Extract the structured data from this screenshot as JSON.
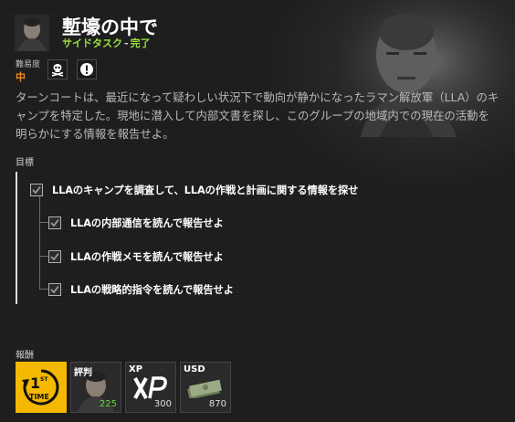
{
  "mission": {
    "title": "塹壕の中で",
    "type_label": "サイドタスク",
    "separator": "-",
    "status": "完了",
    "difficulty_label": "難易度",
    "difficulty_value": "中",
    "description": "ターンコートは、最近になって疑わしい状況下で動向が静かになったラマン解放軍（LLA）のキャンプを特定した。現地に潜入して内部文書を探し、このグループの地域内での現在の活動を明らかにする情報を報告せよ。"
  },
  "modifiers": [
    "skull-icon",
    "exclamation-icon"
  ],
  "objectives": {
    "label": "目標",
    "main": "LLAのキャンプを調査して、LLAの作戦と計画に関する情報を探せ",
    "sub": [
      "LLAの内部通信を読んで報告せよ",
      "LLAの作戦メモを読んで報告せよ",
      "LLAの戦略的指令を読んで報告せよ"
    ]
  },
  "rewards": {
    "label": "報酬",
    "items": [
      {
        "label": "",
        "value": "",
        "badge_top": "1",
        "badge_sup": "ST",
        "badge_bottom": "TIME",
        "icon": "first-time-icon",
        "color": "#f5b800"
      },
      {
        "label": "評判",
        "value": "225",
        "icon": "reputation-portrait"
      },
      {
        "label": "XP",
        "value": "300",
        "icon": "xp-icon"
      },
      {
        "label": "USD",
        "value": "870",
        "icon": "cash-icon"
      }
    ]
  },
  "colors": {
    "status_green": "#9be23c",
    "difficulty_orange": "#f08a24",
    "first_time_yellow": "#f5b800",
    "rep_value_green": "#5fdc3a"
  }
}
